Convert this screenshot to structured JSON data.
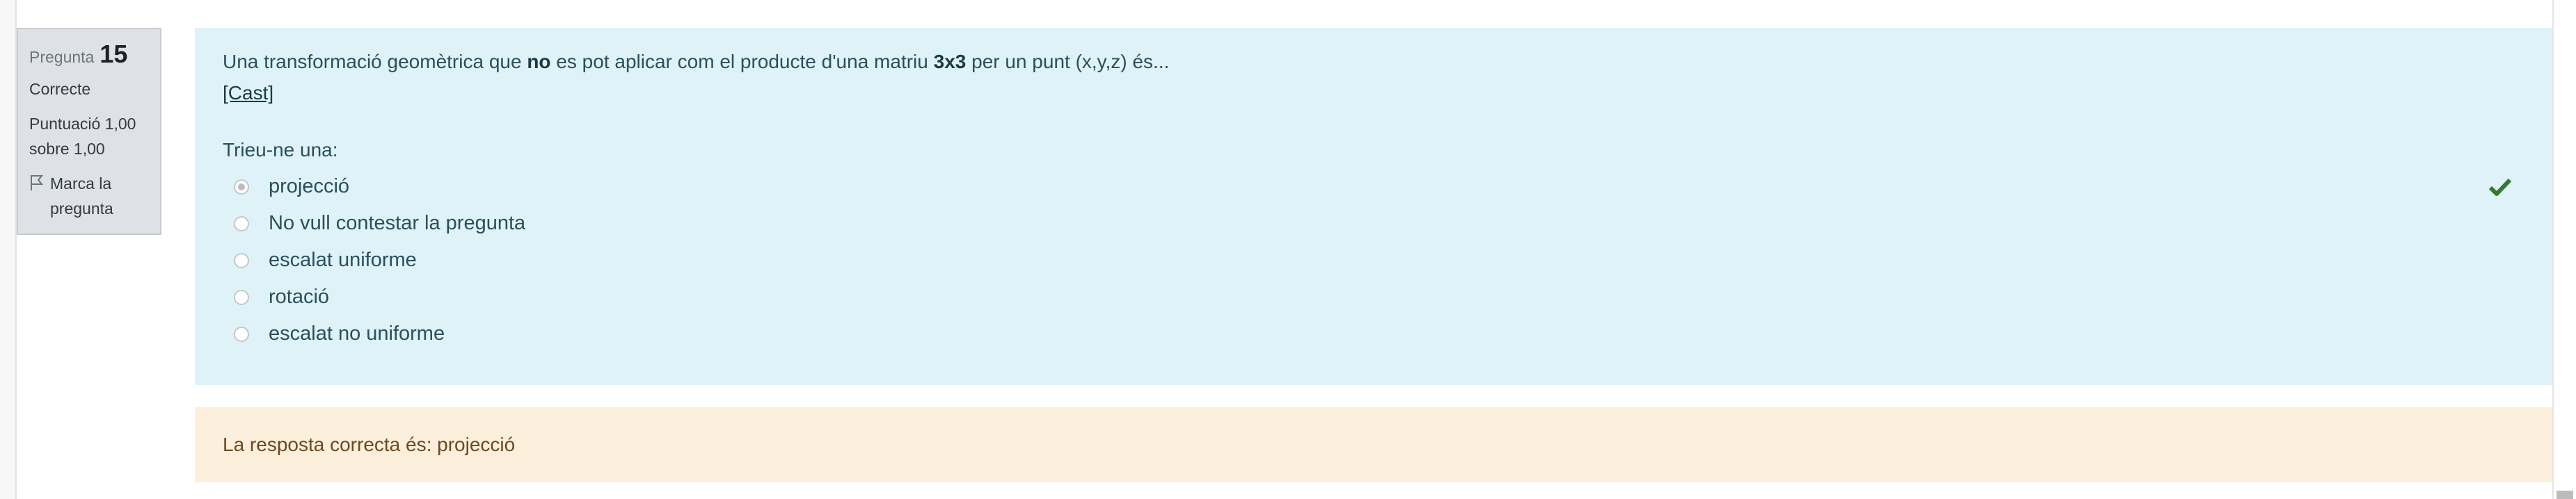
{
  "info": {
    "question_word": "Pregunta",
    "question_number": "15",
    "state": "Correcte",
    "grade_line1": "Puntuació 1,00",
    "grade_line2": "sobre 1,00",
    "flag_line1": "Marca la",
    "flag_line2": "pregunta",
    "flag_icon": "flag-icon"
  },
  "question": {
    "text_part1": "Una transformació geomètrica que ",
    "text_bold1": "no",
    "text_part2": " es pot aplicar com el producte d'una matriu ",
    "text_bold2": "3x3",
    "text_part3": " per un punt (x,y,z) és...",
    "cast_link": "[Cast]",
    "prompt": "Trieu-ne una:",
    "options": [
      {
        "label": "projecció",
        "checked": true
      },
      {
        "label": "No vull contestar la pregunta",
        "checked": false
      },
      {
        "label": "escalat uniforme",
        "checked": false
      },
      {
        "label": "rotació",
        "checked": false
      },
      {
        "label": "escalat no uniforme",
        "checked": false
      }
    ],
    "result_icon": "check-icon",
    "result_color": "#357a32"
  },
  "feedback": {
    "text": "La resposta correcta és: projecció"
  },
  "colors": {
    "content_bg": "#def2f8",
    "feedback_bg": "#fcefdc",
    "info_bg": "#dee2e6"
  }
}
